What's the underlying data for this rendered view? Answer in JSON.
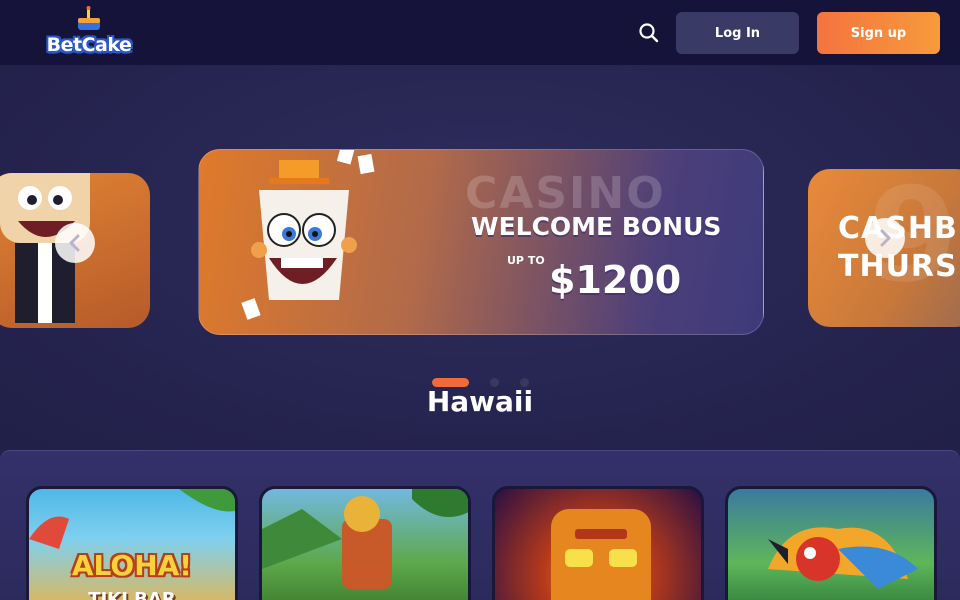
{
  "header": {
    "logo_text": "BetCake",
    "search_icon": "search-icon",
    "login_label": "Log In",
    "signup_label": "Sign up"
  },
  "carousel": {
    "main_slide": {
      "bg_word": "CASINO",
      "title": "WELCOME BONUS",
      "upto": "UP TO",
      "amount": "$1200"
    },
    "right_slide": {
      "line1": "CASHB",
      "line2": "THURS",
      "bg_number": "9"
    },
    "prev_icon": "chevron-left-icon",
    "next_icon": "chevron-right-icon",
    "active_index": 0,
    "total_dots": 3
  },
  "section": {
    "title": "Hawaii"
  },
  "games": [
    {
      "title": "ALOHA!",
      "subtitle": "TIKI BAR"
    },
    {
      "title": "",
      "subtitle": ""
    },
    {
      "title": "",
      "subtitle": ""
    },
    {
      "title": "",
      "subtitle": ""
    }
  ],
  "colors": {
    "header_bg": "#15133a",
    "page_bg": "#24224a",
    "accent": "#f06a3a",
    "login_bg": "#3a3a66"
  }
}
